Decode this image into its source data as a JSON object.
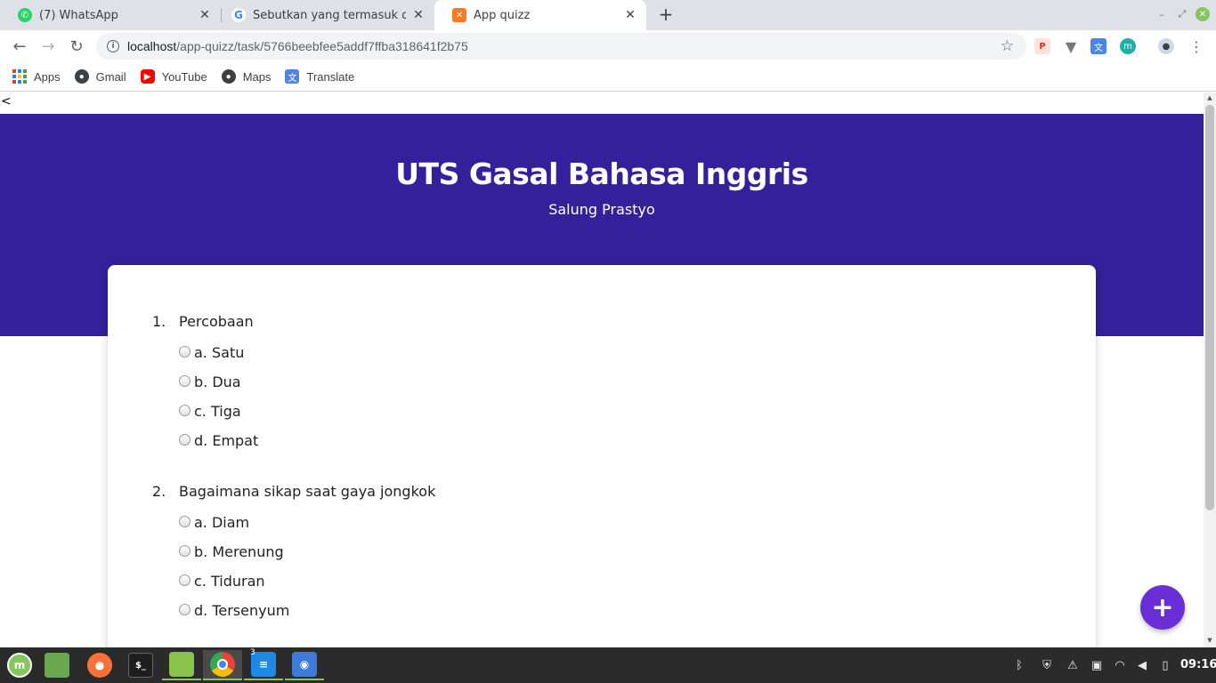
{
  "browser": {
    "tabs": [
      {
        "title": "(7) WhatsApp",
        "icon": "whatsapp-icon",
        "color": "#25d366"
      },
      {
        "title": "Sebutkan yang termasuk dala",
        "icon": "google-icon",
        "color": "#4285f4"
      },
      {
        "title": "App quizz",
        "icon": "xampp-icon",
        "color": "#fb7a24"
      }
    ],
    "url_host": "localhost",
    "url_path": "/app-quizz/task/5766beebfee5addf7ffba318641f2b75",
    "bookmarks": [
      "Apps",
      "Gmail",
      "YouTube",
      "Maps",
      "Translate"
    ]
  },
  "page": {
    "back_link": "<",
    "title": "UTS Gasal Bahasa Inggris",
    "subtitle": "Salung Prastyo",
    "questions": [
      {
        "number": "1.",
        "text": "Percobaan",
        "options": [
          "a. Satu",
          "b. Dua",
          "c. Tiga",
          "d. Empat"
        ]
      },
      {
        "number": "2.",
        "text": "Bagaimana sikap saat gaya jongkok",
        "options": [
          "a. Diam",
          "b. Merenung",
          "c. Tiduran",
          "d. Tersenyum"
        ]
      }
    ],
    "fab_label": "+",
    "colors": {
      "hero": "#35209b",
      "fab": "#6a2ed6"
    }
  },
  "taskbar": {
    "badge": "3",
    "clock": "09:16"
  }
}
